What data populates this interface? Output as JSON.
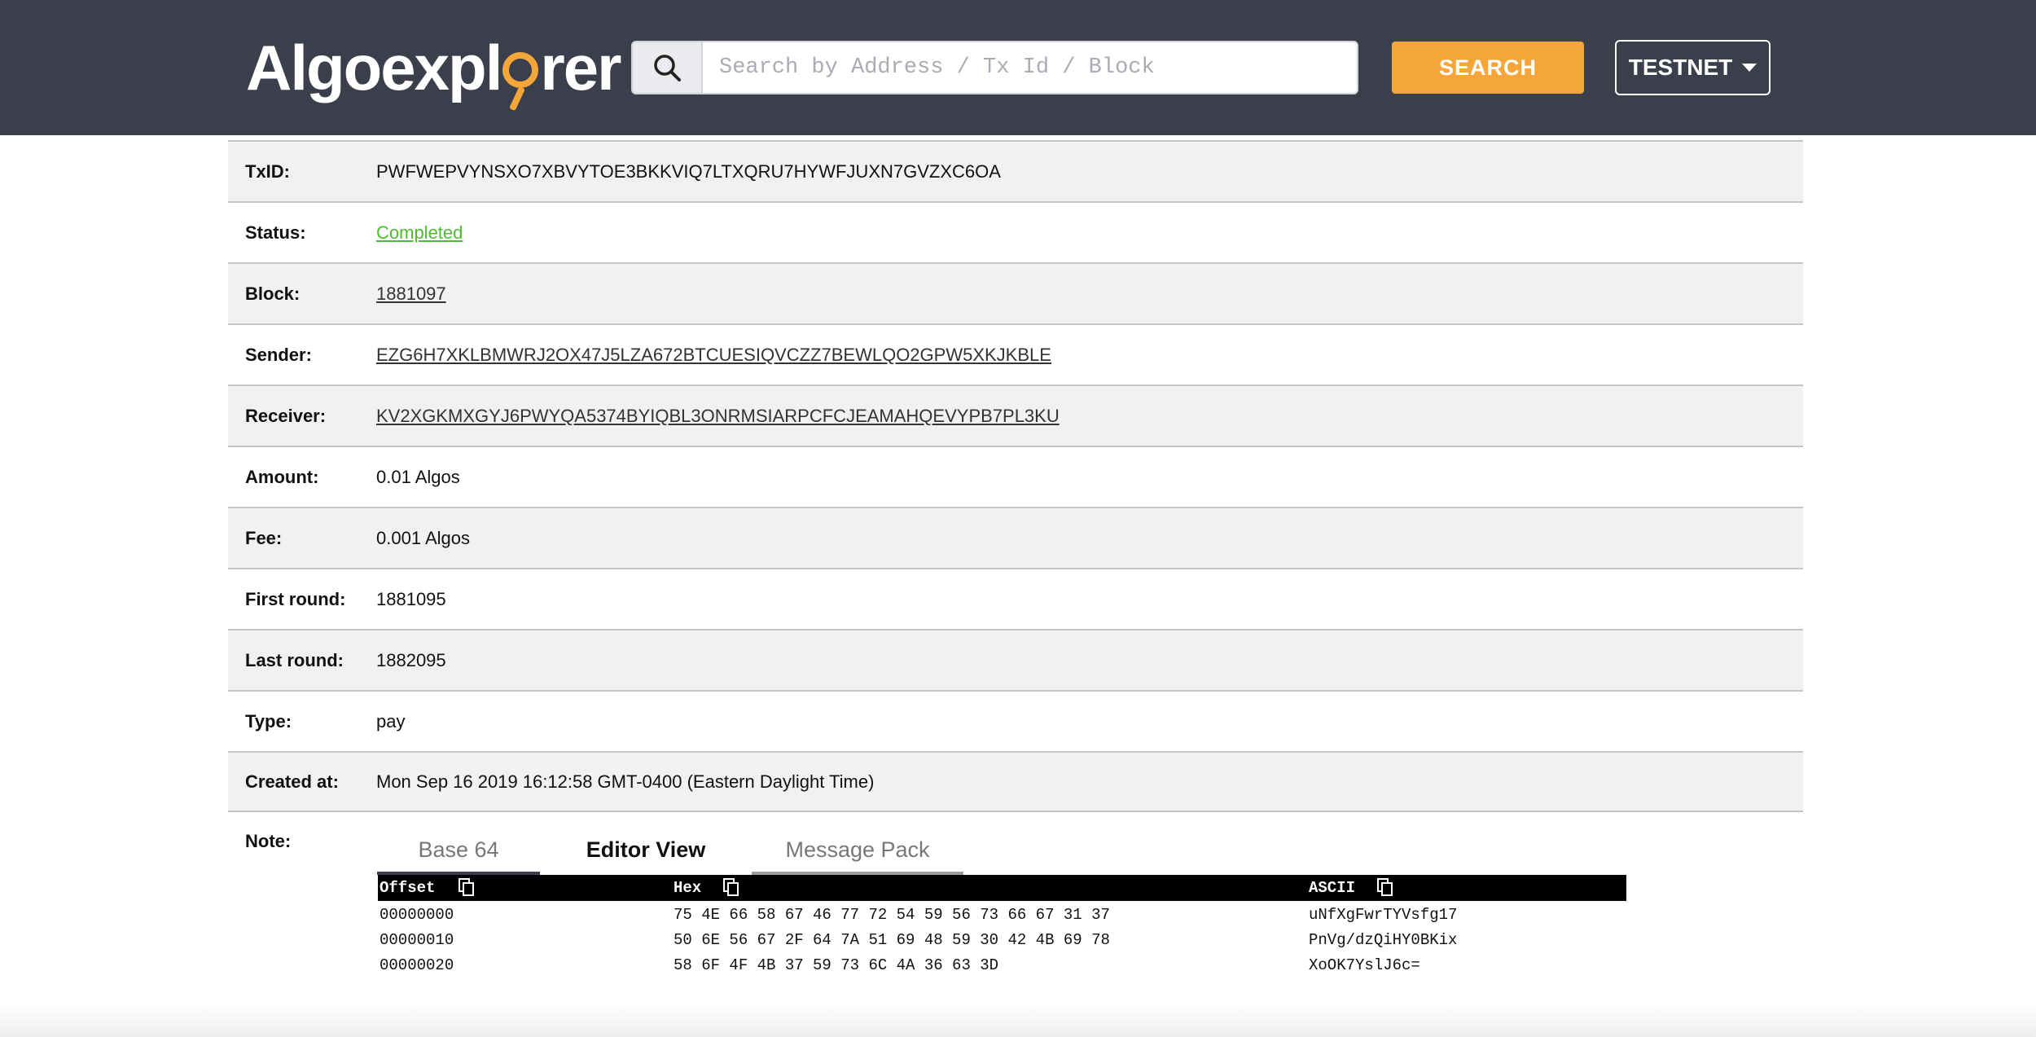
{
  "header": {
    "logo_text_before": "Algoexpl",
    "logo_text_after": "rer",
    "search_placeholder": "Search by Address / Tx Id / Block",
    "search_value": "",
    "search_button": "SEARCH",
    "network": "TESTNET"
  },
  "details": {
    "rows": [
      {
        "label": "TxID:",
        "value": "PWFWEPVYNSXO7XBVYTOE3BKKVIQ7LTXQRU7HYWFJUXN7GVZXC6OA"
      },
      {
        "label": "Status:",
        "value": "Completed"
      },
      {
        "label": "Block:",
        "value": "1881097"
      },
      {
        "label": "Sender:",
        "value": "EZG6H7XKLBMWRJ2OX47J5LZA672BTCUESIQVCZZ7BEWLQO2GPW5XKJKBLE"
      },
      {
        "label": "Receiver:",
        "value": "KV2XGKMXGYJ6PWYQA5374BYIQBL3ONRMSIARPCFCJEAMAHQEVYPB7PL3KU"
      },
      {
        "label": "Amount:",
        "value": "0.01 Algos"
      },
      {
        "label": "Fee:",
        "value": "0.001 Algos"
      },
      {
        "label": "First round:",
        "value": "1881095"
      },
      {
        "label": "Last round:",
        "value": "1882095"
      },
      {
        "label": "Type:",
        "value": "pay"
      },
      {
        "label": "Created at:",
        "value": "Mon Sep 16 2019 16:12:58 GMT-0400 (Eastern Daylight Time)"
      }
    ]
  },
  "note": {
    "label": "Note:",
    "tabs": [
      {
        "label": "Base 64",
        "active": false
      },
      {
        "label": "Editor View",
        "active": true
      },
      {
        "label": "Message Pack",
        "active": false
      }
    ],
    "hex": {
      "headers": {
        "offset": "Offset",
        "hex": "Hex",
        "ascii": "ASCII"
      },
      "rows": [
        {
          "offset": "00000000",
          "hex": "75 4E 66 58 67 46 77 72 54 59 56 73 66 67 31 37",
          "ascii": "uNfXgFwrTYVsfg17"
        },
        {
          "offset": "00000010",
          "hex": "50 6E 56 67 2F 64 7A 51 69 48 59 30 42 4B 69 78",
          "ascii": "PnVg/dzQiHY0BKix"
        },
        {
          "offset": "00000020",
          "hex": "58 6F 4F 4B 37 59 73 6C 4A 36 63 3D",
          "ascii": "XoOK7YslJ6c="
        }
      ]
    }
  },
  "colors": {
    "header_bg": "#3a3f4b",
    "accent": "#f4a63a",
    "status_ok": "#4cbc2f",
    "row_shade": "#f1f1f1"
  },
  "icons": [
    "search-icon",
    "caret-down-icon",
    "copy-icon"
  ]
}
